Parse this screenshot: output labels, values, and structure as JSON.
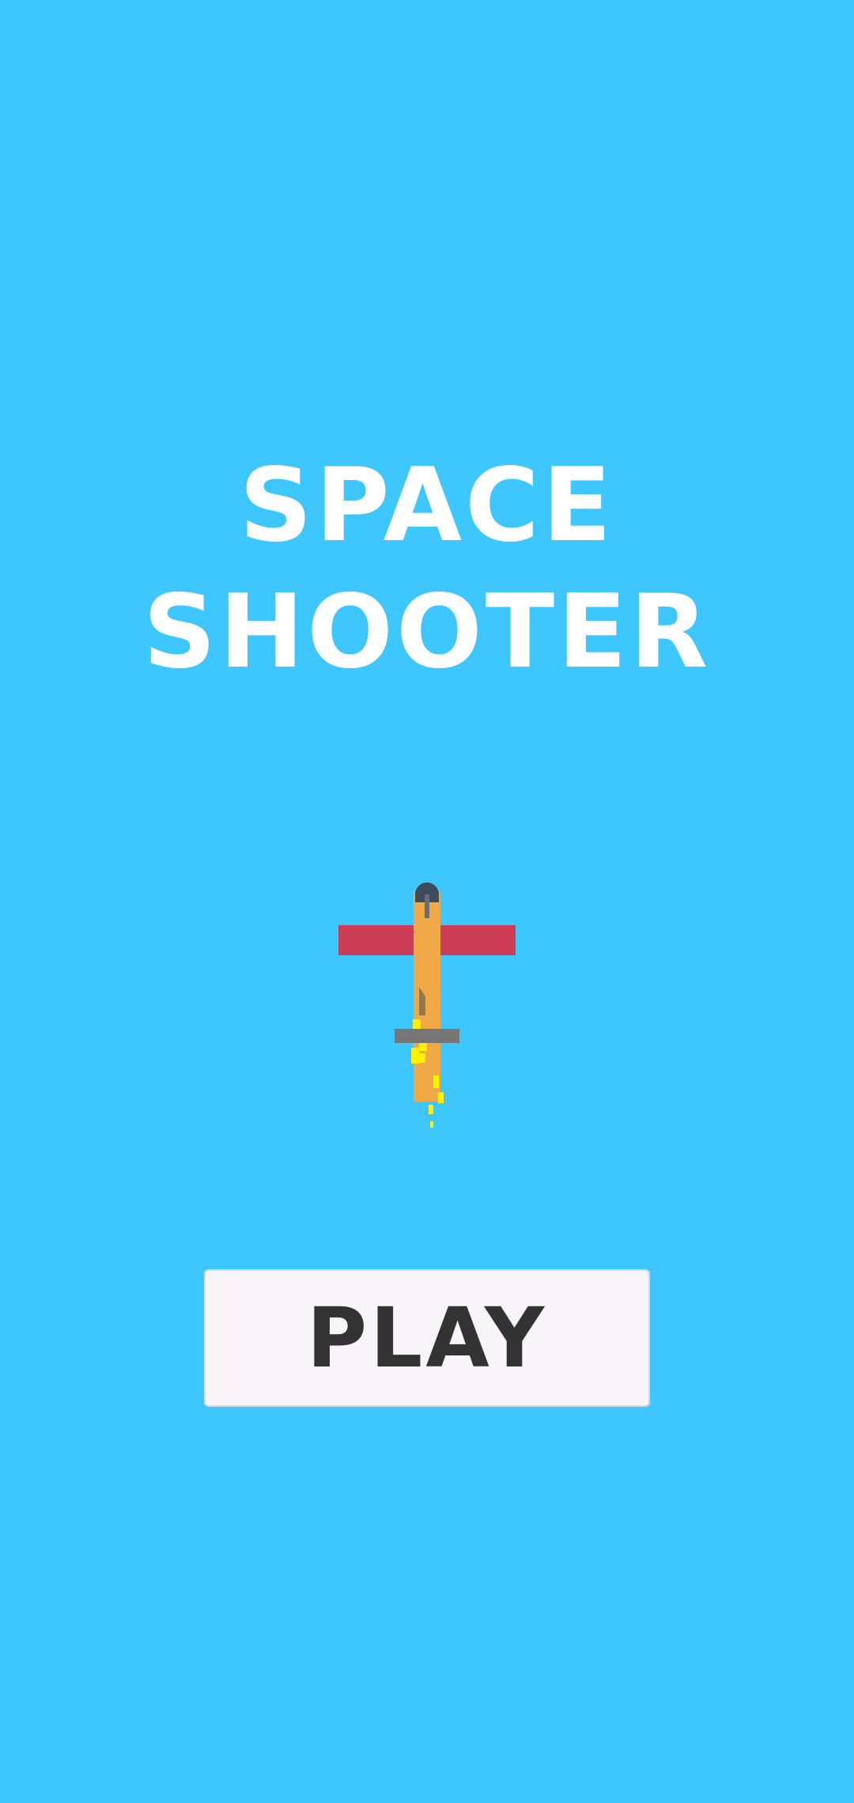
{
  "game": {
    "title_line1": "SPACE",
    "title_line2": "SHOOTER",
    "play_label": "PLAY"
  },
  "colors": {
    "background": "#3EC6FF",
    "title": "#FFFFFF",
    "button_bg": "#F7F5F8",
    "button_text": "#333333",
    "plane_body": "#EFAA47",
    "plane_wings": "#CC3D55",
    "plane_tail": "#767676",
    "exhaust": "#FFF200"
  },
  "icons": {
    "player_ship": "airplane-icon"
  }
}
